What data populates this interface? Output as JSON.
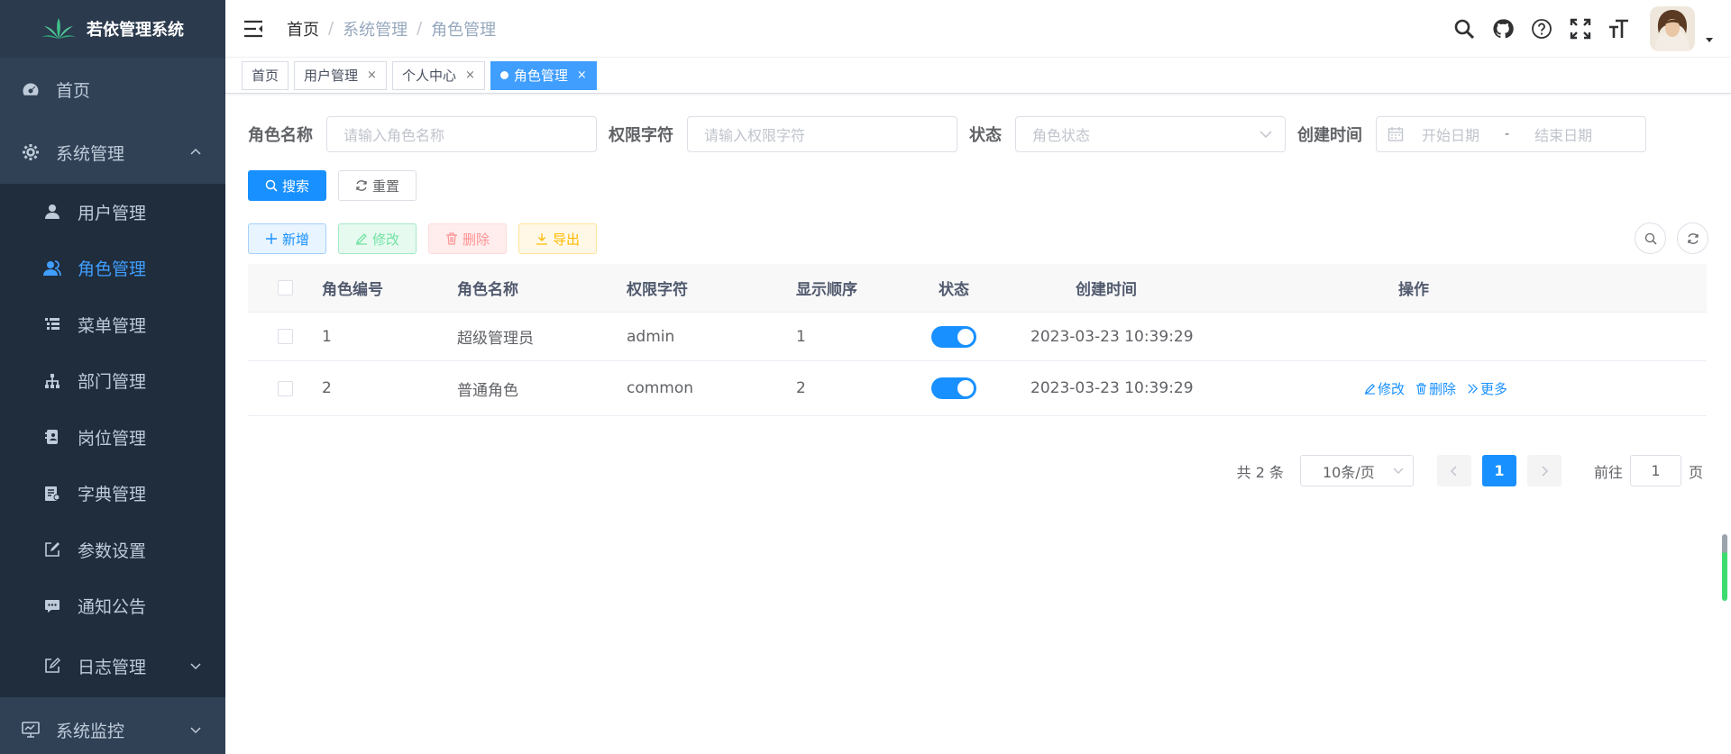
{
  "app": {
    "title": "若依管理系统"
  },
  "sidebar": {
    "home": "首页",
    "system": "系统管理",
    "items": [
      {
        "label": "用户管理",
        "icon": "user-icon"
      },
      {
        "label": "角色管理",
        "icon": "peoples-icon",
        "active": true
      },
      {
        "label": "菜单管理",
        "icon": "tree-table-icon"
      },
      {
        "label": "部门管理",
        "icon": "tree-icon"
      },
      {
        "label": "岗位管理",
        "icon": "post-icon"
      },
      {
        "label": "字典管理",
        "icon": "dict-icon"
      },
      {
        "label": "参数设置",
        "icon": "edit-icon"
      },
      {
        "label": "通知公告",
        "icon": "message-icon"
      },
      {
        "label": "日志管理",
        "icon": "log-icon"
      }
    ],
    "monitor": "系统监控"
  },
  "breadcrumb": {
    "first": "首页",
    "mid": "系统管理",
    "last": "角色管理",
    "sep": "/"
  },
  "tags": [
    {
      "label": "首页"
    },
    {
      "label": "用户管理",
      "close": "×"
    },
    {
      "label": "个人中心",
      "close": "×"
    },
    {
      "label": "角色管理",
      "close": "×",
      "active": true
    }
  ],
  "search": {
    "role_name_label": "角色名称",
    "role_name_placeholder": "请输入角色名称",
    "role_key_label": "权限字符",
    "role_key_placeholder": "请输入权限字符",
    "status_label": "状态",
    "status_placeholder": "角色状态",
    "created_label": "创建时间",
    "start_placeholder": "开始日期",
    "date_sep": "-",
    "end_placeholder": "结束日期",
    "search_btn": "搜索",
    "reset_btn": "重置"
  },
  "toolbar": {
    "add": "新增",
    "edit": "修改",
    "delete": "删除",
    "export": "导出"
  },
  "table": {
    "headers": {
      "id": "角色编号",
      "name": "角色名称",
      "key": "权限字符",
      "sort": "显示顺序",
      "status": "状态",
      "created": "创建时间",
      "ops": "操作"
    },
    "rows": [
      {
        "id": "1",
        "name": "超级管理员",
        "key": "admin",
        "sort": "1",
        "enabled": true,
        "created": "2023-03-23 10:39:29"
      },
      {
        "id": "2",
        "name": "普通角色",
        "key": "common",
        "sort": "2",
        "enabled": true,
        "created": "2023-03-23 10:39:29",
        "ops": {
          "edit": "修改",
          "delete": "删除",
          "more": "更多"
        }
      }
    ]
  },
  "pagination": {
    "total": "共 2 条",
    "page_size": "10条/页",
    "current": "1",
    "goto_prefix": "前往",
    "goto_value": "1",
    "goto_suffix": "页"
  },
  "colors": {
    "sidebar_bg": "#304156",
    "submenu_bg": "#1f2d3d",
    "primary": "#1890ff",
    "active_menu": "#409eff"
  }
}
